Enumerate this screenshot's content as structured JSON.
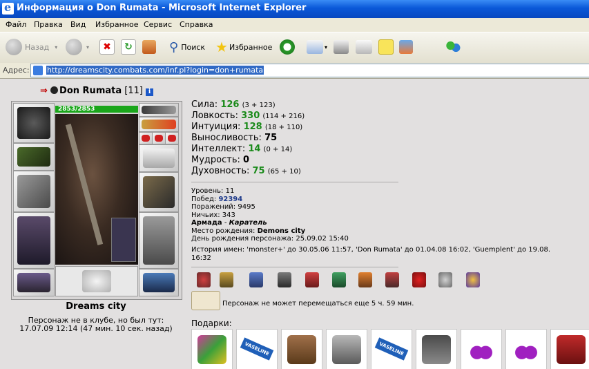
{
  "window": {
    "title": "Информация о Don Rumata - Microsoft Internet Explorer"
  },
  "menu": [
    "Файл",
    "Правка",
    "Вид",
    "Избранное",
    "Сервис",
    "Справка"
  ],
  "toolbar": {
    "back": "Назад",
    "search": "Поиск",
    "favorites": "Избранное"
  },
  "address": {
    "label": "Адрес:",
    "url": "http://dreamscity.combats.com/inf.pl?login=don+rumata"
  },
  "character": {
    "name": "Don Rumata",
    "level_tag": "[11]",
    "hp": "2853/2853",
    "hp_fraction": 1.0
  },
  "stats": [
    {
      "label": "Сила:",
      "value": "126",
      "detail": "(3 + 123)",
      "color": "#1a8a1a"
    },
    {
      "label": "Ловкость:",
      "value": "330",
      "detail": "(114 + 216)",
      "color": "#1a8a1a"
    },
    {
      "label": "Интуиция:",
      "value": "128",
      "detail": "(18 + 110)",
      "color": "#1a8a1a"
    },
    {
      "label": "Выносливость:",
      "value": "75",
      "detail": "",
      "color": "#000000"
    },
    {
      "label": "Интеллект:",
      "value": "14",
      "detail": "(0 + 14)",
      "color": "#1a8a1a"
    },
    {
      "label": "Мудрость:",
      "value": "0",
      "detail": "",
      "color": "#000000"
    },
    {
      "label": "Духовность:",
      "value": "75",
      "detail": "(65 + 10)",
      "color": "#1a8a1a"
    }
  ],
  "info": {
    "level_label": "Уровень:",
    "level": "11",
    "wins_label": "Побед:",
    "wins": "92394",
    "losses_label": "Поражений:",
    "losses": "9495",
    "draws_label": "Ничьих:",
    "draws": "343",
    "clan": "Армада",
    "clan_sep": " - ",
    "clan_rank": "Каратель",
    "birthplace_label": "Место рождения:",
    "birthplace": "Demons city",
    "birthday_label": "День рождения персонажа:",
    "birthday": "25.09.02 15:40",
    "history_line1": "История имен: 'monster+' до 30.05.06 11:57, 'Don Rumata' до 01.04.08 16:02, 'Guemplent' до 19.08.",
    "history_line2": "16:32"
  },
  "travel_text": "Персонаж не может перемещаться еще 5 ч. 59 мин.",
  "city": "Dreams city",
  "location_line1": "Персонаж не в клубе, но был тут:",
  "location_line2": "17.07.09 12:14 (47 мин. 10 сек. назад)",
  "gifts_label": "Подарки:",
  "gift_vaseline_label": "VASELINE",
  "badges": [
    "badge-1",
    "badge-2",
    "badge-3",
    "badge-4",
    "badge-5",
    "badge-6",
    "badge-7",
    "badge-8",
    "badge-9",
    "badge-10",
    "badge-11",
    "badge-12"
  ],
  "colors": {
    "hp_bar": "#1aa61a",
    "stat_green": "#1a8a1a",
    "wins_blue": "#1e3a8a",
    "title_blue": "#0a58d8"
  }
}
